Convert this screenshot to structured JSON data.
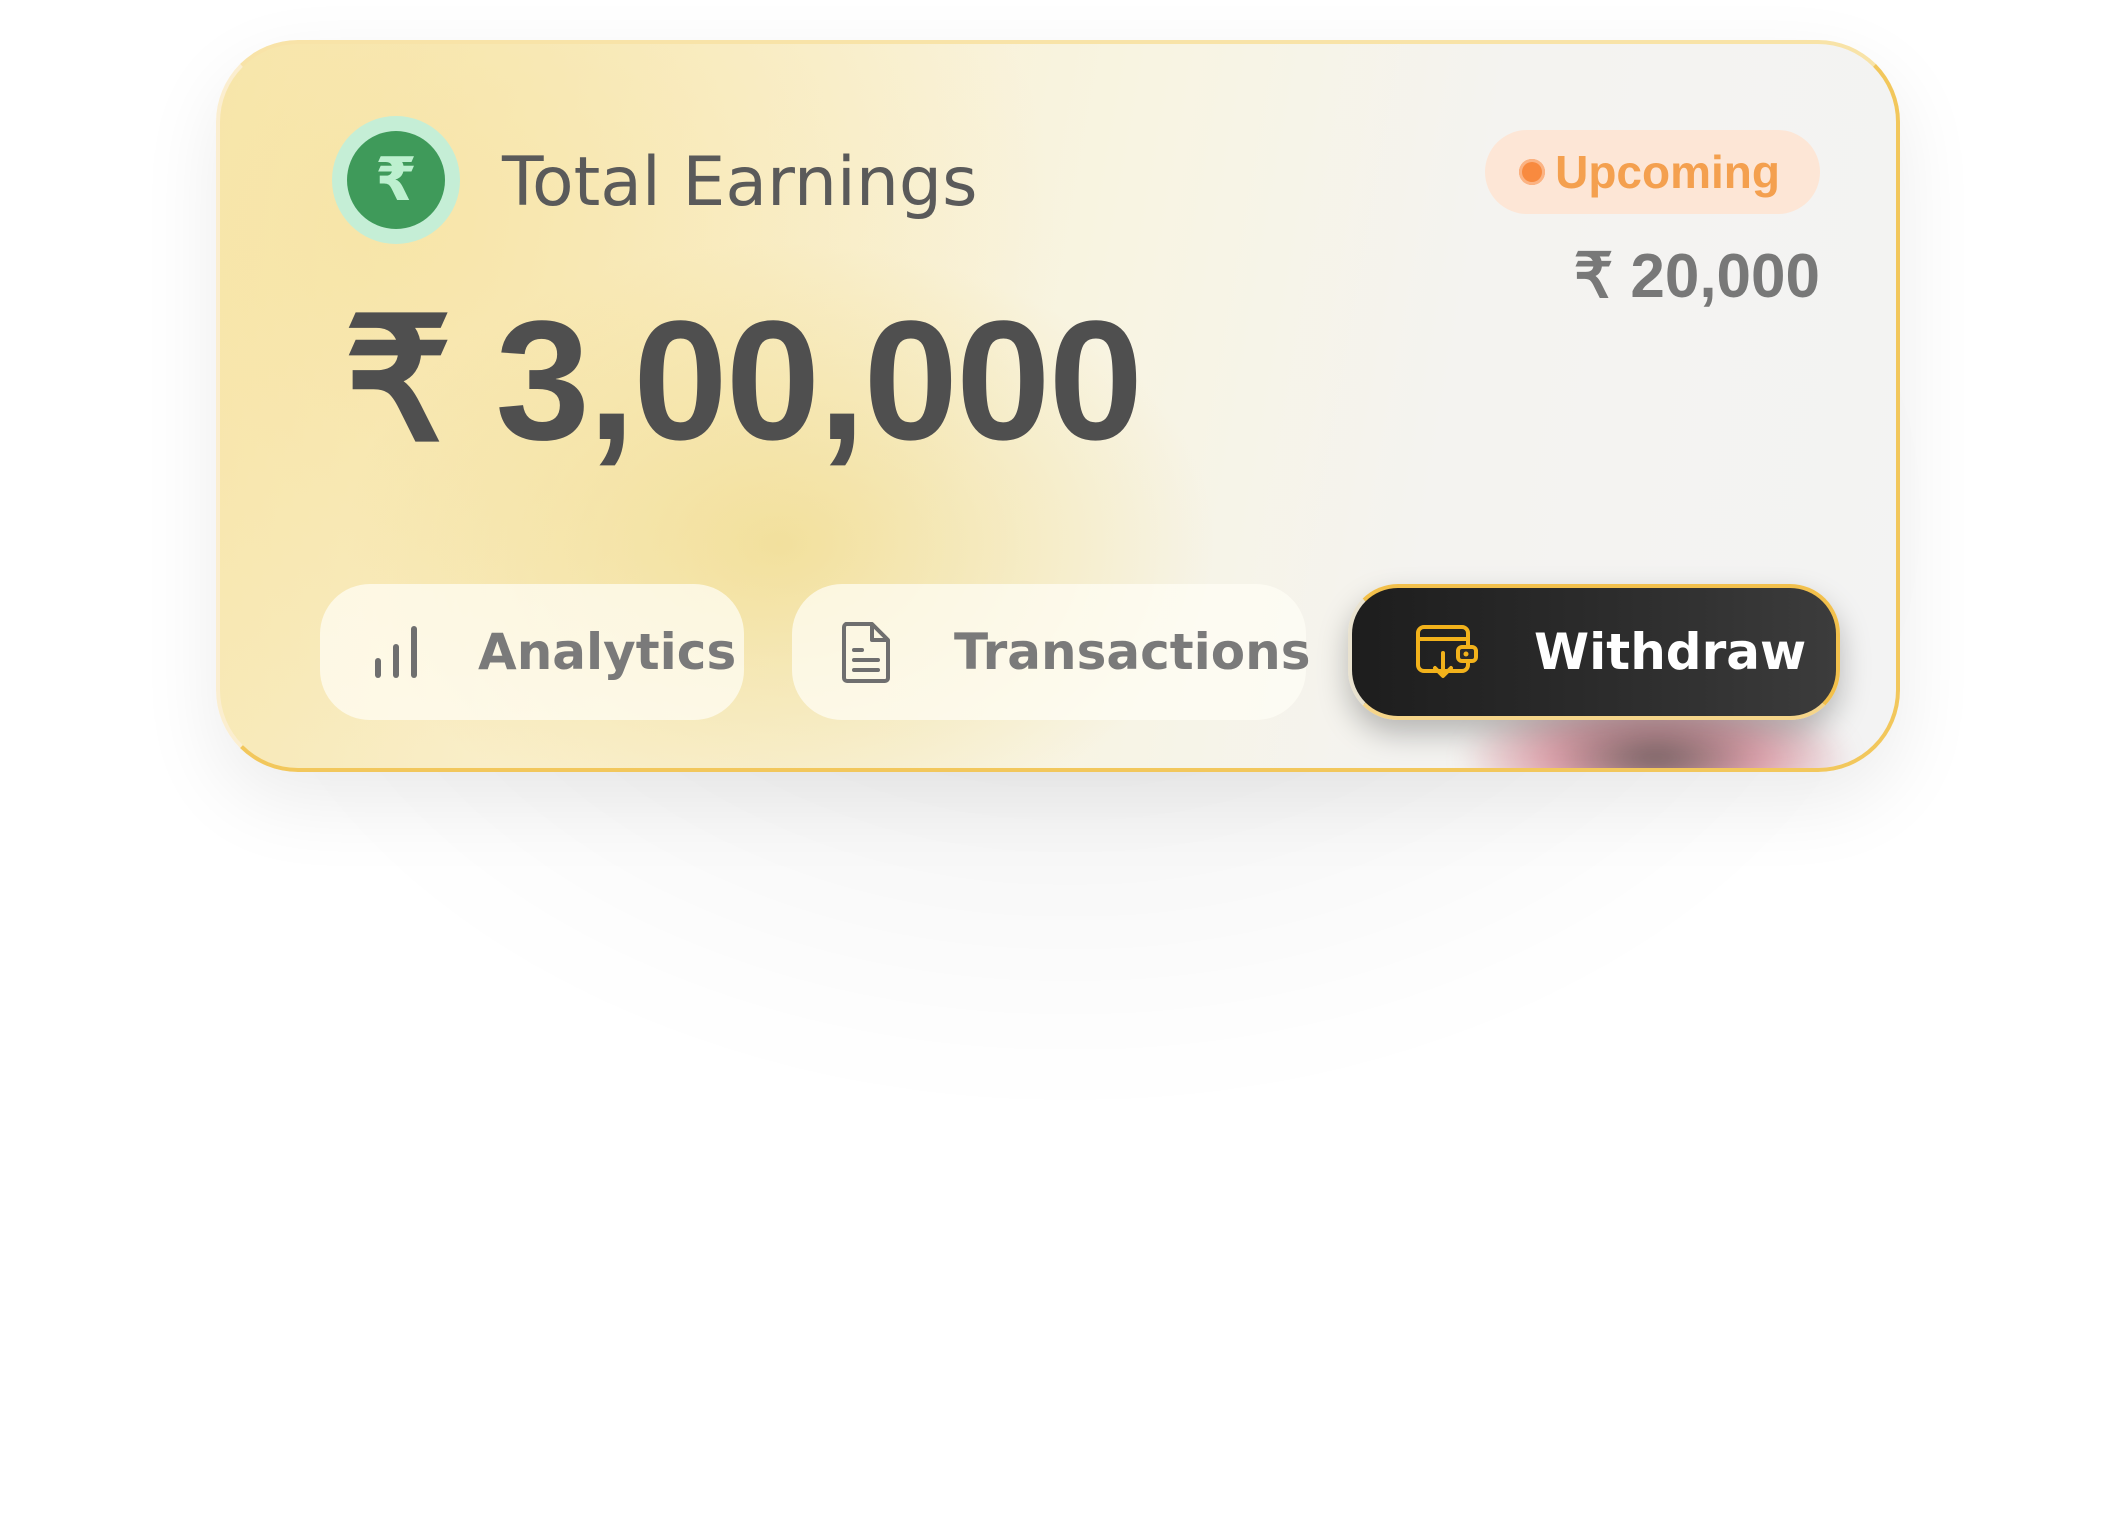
{
  "card": {
    "icon": "rupee-icon",
    "icon_glyph": "₹",
    "title": "Total Earnings",
    "amount": "₹ 3,00,000"
  },
  "upcoming": {
    "badge_label": "Upcoming",
    "amount": "₹ 20,000"
  },
  "actions": [
    {
      "label": "Analytics",
      "icon": "bar-chart-icon"
    },
    {
      "label": "Transactions",
      "icon": "document-icon"
    },
    {
      "label": "Withdraw",
      "icon": "wallet-withdraw-icon"
    }
  ],
  "colors": {
    "brand_green": "#3f9a5a",
    "badge_orange": "#f4a04f",
    "withdraw_accent": "#f2b21b",
    "text_dark": "#4f4f4f"
  }
}
